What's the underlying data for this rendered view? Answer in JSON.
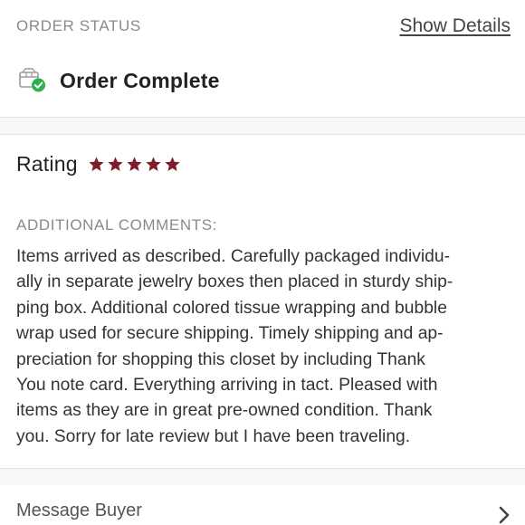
{
  "order_status": {
    "label": "ORDER STATUS",
    "show_details_label": "Show Details",
    "status_text": "Order Complete",
    "status_icon": "package-check-icon",
    "check_color": "#2bb24c"
  },
  "rating": {
    "label": "Rating",
    "stars": 5,
    "max_stars": 5,
    "star_color": "#7f1d2d"
  },
  "comments": {
    "label": "ADDITIONAL COMMENTS:",
    "lines": [
      "Items arrived as described. Carefully packaged individu-",
      "ally in separate jewelry boxes then placed in sturdy ship-",
      "ping box. Additional colored tissue wrapping and bubble",
      "wrap used for secure shipping. Timely shipping and ap-",
      "preciation for shopping this closet by including Thank",
      "You note card. Everything arriving in tact. Pleased with",
      "items as they are in great pre-owned condition. Thank",
      "you. Sorry for late review but I have been traveling."
    ]
  },
  "message": {
    "label": "Message Buyer",
    "icon": "chevron-right-icon"
  }
}
